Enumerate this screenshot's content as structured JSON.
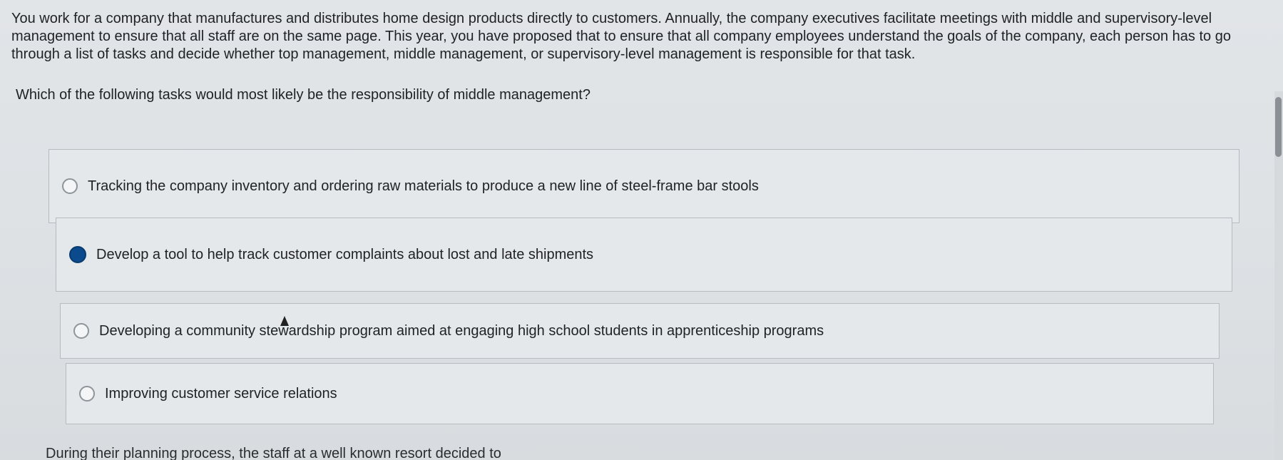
{
  "intro": "You work for a company that manufactures and distributes home design products directly to customers. Annually, the company executives facilitate meetings with middle and supervisory-level management to ensure that all staff are on the same page. This year, you have proposed that to ensure that all company employees understand the goals of the company, each person has to go through a list of tasks and decide whether top management, middle management, or supervisory-level management is responsible for that task.",
  "question": "Which of the following tasks would most likely be the responsibility of middle management?",
  "options": [
    {
      "label": "Tracking the company inventory and ordering raw materials to produce a new line of steel-frame bar stools",
      "selected": false
    },
    {
      "label": "Develop a tool to help track customer complaints about lost and late shipments",
      "selected": true
    },
    {
      "label": "Developing a community stewardship program aimed at engaging high school students in apprenticeship programs",
      "selected": false
    },
    {
      "label": "Improving customer service relations",
      "selected": false
    }
  ],
  "footer_text": "During their planning process, the staff at a well known resort decided to",
  "colors": {
    "selected_radio": "#0b4a8c",
    "background": "#dde1e4"
  }
}
